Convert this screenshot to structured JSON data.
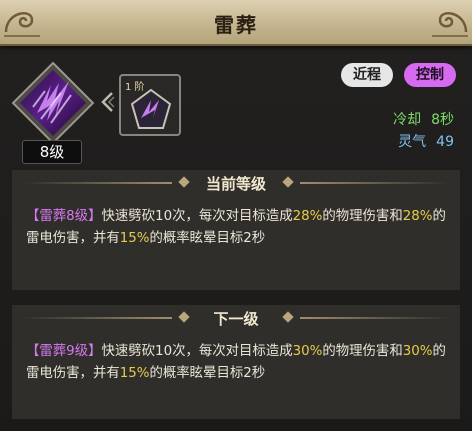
{
  "header": {
    "title": "雷葬"
  },
  "skill": {
    "level_label": "8级",
    "rune_tier": "1 阶"
  },
  "tags": {
    "range": "近程",
    "control": "控制"
  },
  "stats": {
    "cooldown_label": "冷却",
    "cooldown_value": "8秒",
    "energy_label": "灵气",
    "energy_value": "49"
  },
  "current": {
    "header": "当前等级",
    "name": "【雷葬8级】",
    "text1": "快速劈砍10次，每次对目标造成",
    "pct1": "28%",
    "text2": "的物理伤害和",
    "pct2": "28%",
    "text3": "的雷电伤害，并有",
    "pct3": "15%",
    "text4": "的概率眩晕目标2秒"
  },
  "next": {
    "header": "下一级",
    "name": "【雷葬9级】",
    "text1": "快速劈砍10次，每次对目标造成",
    "pct1": "30%",
    "text2": "的物理伤害和",
    "pct2": "30%",
    "text3": "的雷电伤害，并有",
    "pct3": "15%",
    "text4": "的概率眩晕目标2秒"
  },
  "colors": {
    "title_bar": "#c6b68f",
    "skill_purple": "#b14de0",
    "highlight": "#e7cc4c",
    "cooldown": "#7cdc6b",
    "energy": "#7ec2ef"
  }
}
